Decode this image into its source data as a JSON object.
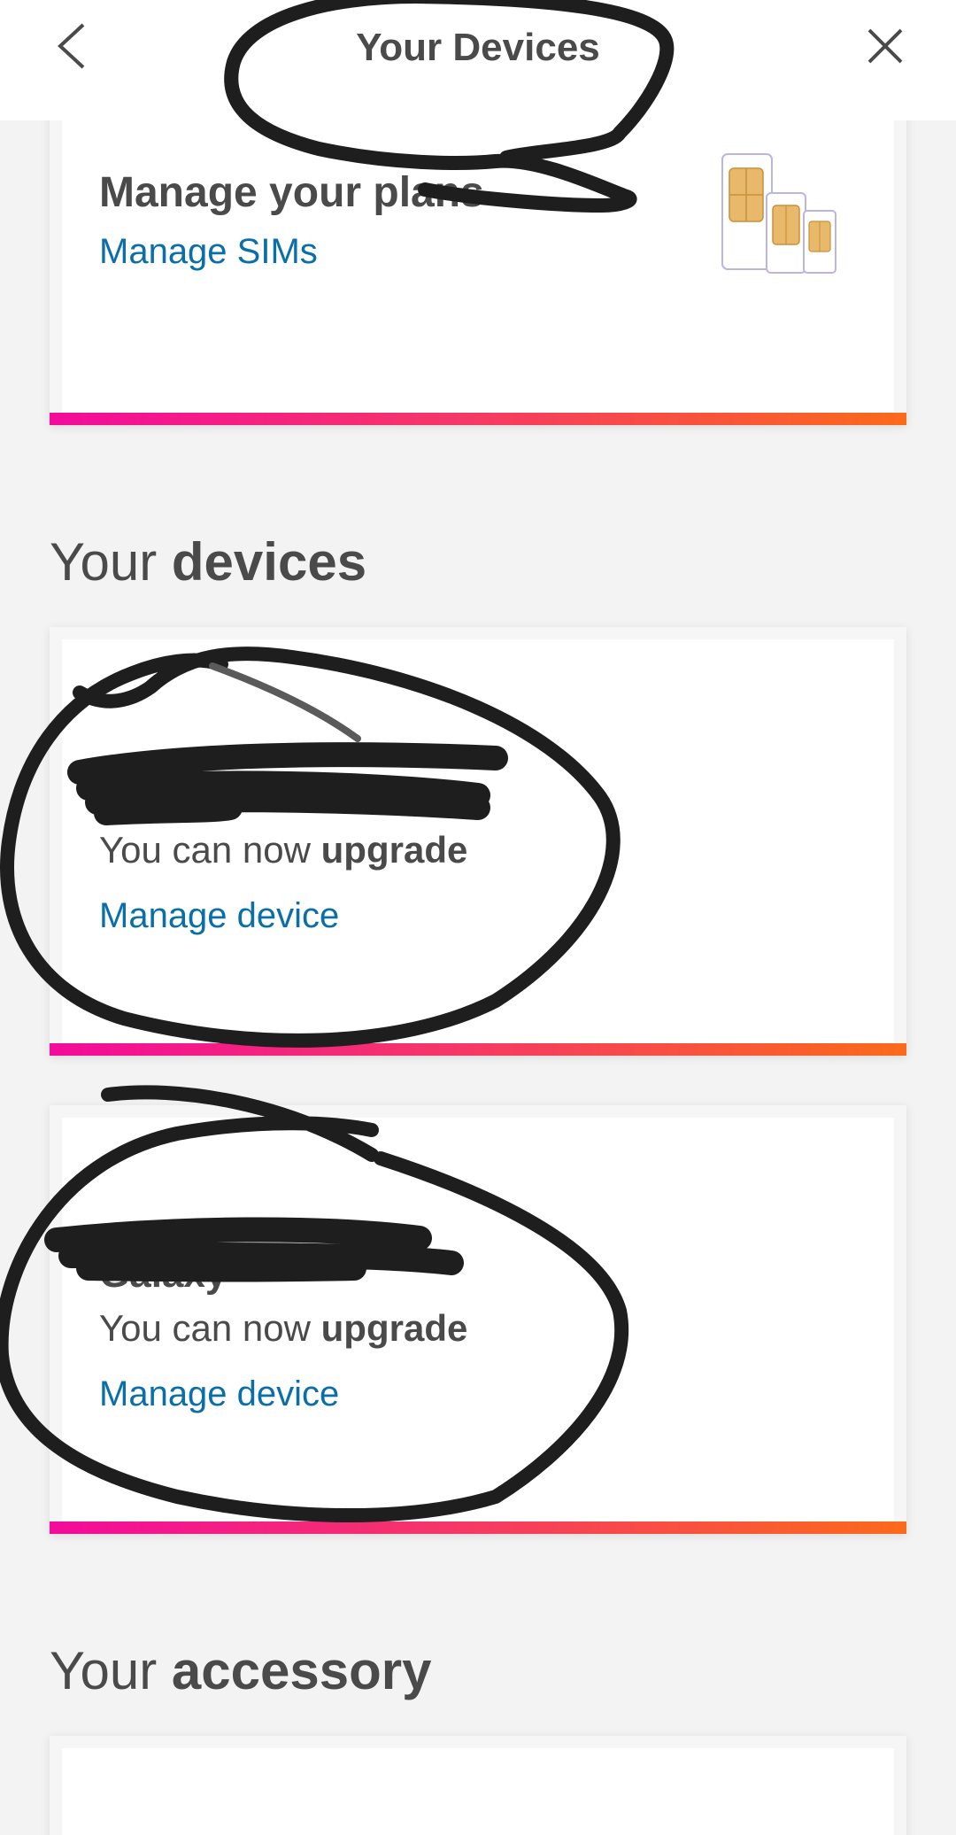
{
  "header": {
    "title": "Your Devices",
    "back_icon": "chevron-left-icon",
    "close_icon": "close-icon"
  },
  "plans_card": {
    "title": "Manage your plans",
    "link": "Manage SIMs",
    "image_icon": "sim-cards-icon"
  },
  "devices_section": {
    "title_prefix": "Your",
    "title_bold": "devices"
  },
  "devices": [
    {
      "name": "",
      "upgrade_prefix": "You can now",
      "upgrade_bold": "upgrade",
      "link": "Manage device"
    },
    {
      "name": "Galaxy",
      "upgrade_prefix": "You can now",
      "upgrade_bold": "upgrade",
      "link": "Manage device"
    }
  ],
  "accessory_section": {
    "title_prefix": "Your",
    "title_bold": "accessory"
  },
  "colors": {
    "link": "#0a6fa8",
    "text": "#4a4a4a",
    "bar_start": "#f30b9a",
    "bar_end": "#fb6a1a",
    "background": "#f3f3f3"
  }
}
